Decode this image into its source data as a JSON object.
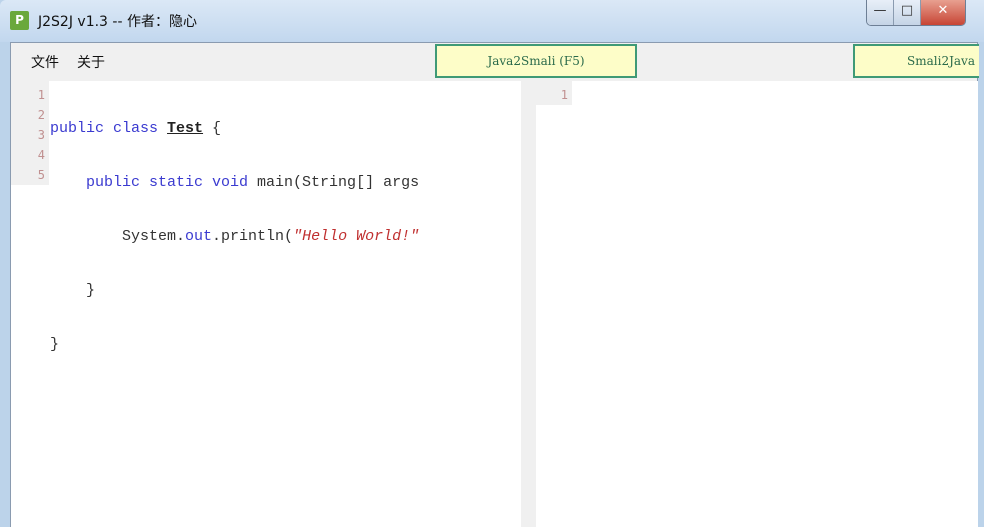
{
  "window": {
    "title": "J2S2J v1.3  -- 作者：隐心",
    "icon_letter": "P",
    "minimize": "—",
    "maximize": "□",
    "close": "✕"
  },
  "menu": [
    "文件",
    "关于"
  ],
  "buttons": {
    "java2smali": "Java2Smali (F5)",
    "smali2java": "Smali2Java"
  },
  "left_editor": {
    "line_numbers": [
      "1",
      "2",
      "3",
      "4",
      "5"
    ],
    "code": {
      "l1": {
        "kw": "public class ",
        "cls": "Test",
        "rest": " {"
      },
      "l2": {
        "indent": "    ",
        "kw": "public static void ",
        "rest": "main(String[] args"
      },
      "l3": {
        "indent": "        ",
        "a": "System.",
        "b": "out",
        "c": ".println(",
        "str": "\"Hello World!\""
      },
      "l4": "    }",
      "l5": "}"
    }
  },
  "right_editor": {
    "line_numbers": [
      "1"
    ]
  }
}
